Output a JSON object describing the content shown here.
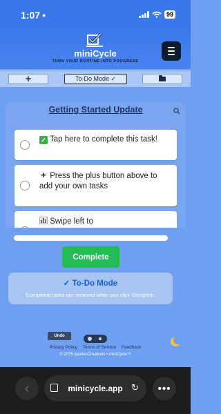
{
  "status": {
    "time": "1:07",
    "battery": "99"
  },
  "header": {
    "title": "miniCycle",
    "tagline": "TURN YOUR ROUTINE INTO PROGRESS"
  },
  "toolbar": {
    "add_label": "+",
    "mode_label": "To-Do Mode ✓"
  },
  "list": {
    "title": "Getting Started Update",
    "tasks": [
      {
        "text": "Tap here to complete this task!",
        "icon": "check-box-emoji-icon"
      },
      {
        "text": "Press the plus button above to add your own tasks",
        "icon": "plus-emoji-icon"
      },
      {
        "text": "Swipe left to",
        "icon": "chart-emoji-icon"
      }
    ]
  },
  "progress": {
    "value": 0
  },
  "complete_label": "Complete",
  "mode_info": {
    "title": "✓ To-Do Mode",
    "description": "Completed tasks are removed when you click Complete."
  },
  "footer": {
    "undo_label": "Undo",
    "links": [
      "Privacy Policy",
      "Terms of Service",
      "Feedback"
    ],
    "copyright": "© 2025 sparkinCreations • miniCycle™"
  },
  "browser": {
    "url": "minicycle.app"
  },
  "colors": {
    "accent": "#3a78ea",
    "complete_green": "#22bb55",
    "mode_blue": "#1a5fd0"
  }
}
